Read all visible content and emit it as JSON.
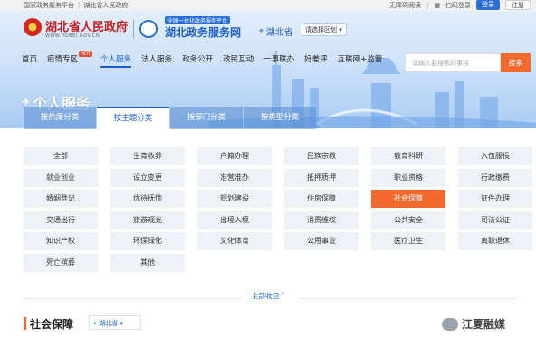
{
  "topbar": {
    "left_links": [
      "国家政务服务平台",
      "湖北省人民政府"
    ],
    "accessibility": "无障碍阅读",
    "qr_login": "扫码登录",
    "login": "登录",
    "register": "注册"
  },
  "header": {
    "gov_name": "湖北省人民政府",
    "gov_sub": "WWW.HUBEI.GOV.CN",
    "svc_tag": "全国一体化政务服务平台",
    "svc_name": "湖北政务服务网",
    "location": "湖北省",
    "region_button": "请选择区划"
  },
  "nav": {
    "items": [
      "首页",
      "疫情专区",
      "个人服务",
      "法人服务",
      "政务公开",
      "政民互动",
      "一事联办",
      "好差评",
      "互联网+监管"
    ],
    "hot_badge": "HOT",
    "active_index": 2
  },
  "search": {
    "placeholder": "请输入要搜索的事项",
    "button": "搜索"
  },
  "page_title": "个人服务",
  "tabs": [
    "按热度分类",
    "按主题分类",
    "按部门分类",
    "按类型分类"
  ],
  "active_tab": 1,
  "topics": [
    [
      "全部",
      "生育收养",
      "户籍办理",
      "民族宗教",
      "教育科研",
      "入伍服役"
    ],
    [
      "就业创业",
      "设立变更",
      "准营准办",
      "抵押质押",
      "职业资格",
      "行政缴费"
    ],
    [
      "婚姻登记",
      "优待抚恤",
      "规划建设",
      "住房保障",
      "社会保障",
      "证件办理"
    ],
    [
      "交通出行",
      "旅游观光",
      "出境入境",
      "消费维权",
      "公共安全",
      "司法公证"
    ],
    [
      "知识产权",
      "环保绿化",
      "文化体育",
      "公用事业",
      "医疗卫生",
      "离职退休"
    ],
    [
      "死亡殡葬",
      "其他"
    ]
  ],
  "active_topic": "社会保障",
  "collapse_label": "全部收回",
  "section": {
    "title": "社会保障",
    "location": "湖北省"
  },
  "watermark": "江夏融媒",
  "colors": {
    "primary": "#1d5fc8",
    "accent": "#f26a2e",
    "brand_red": "#c21f1f"
  }
}
